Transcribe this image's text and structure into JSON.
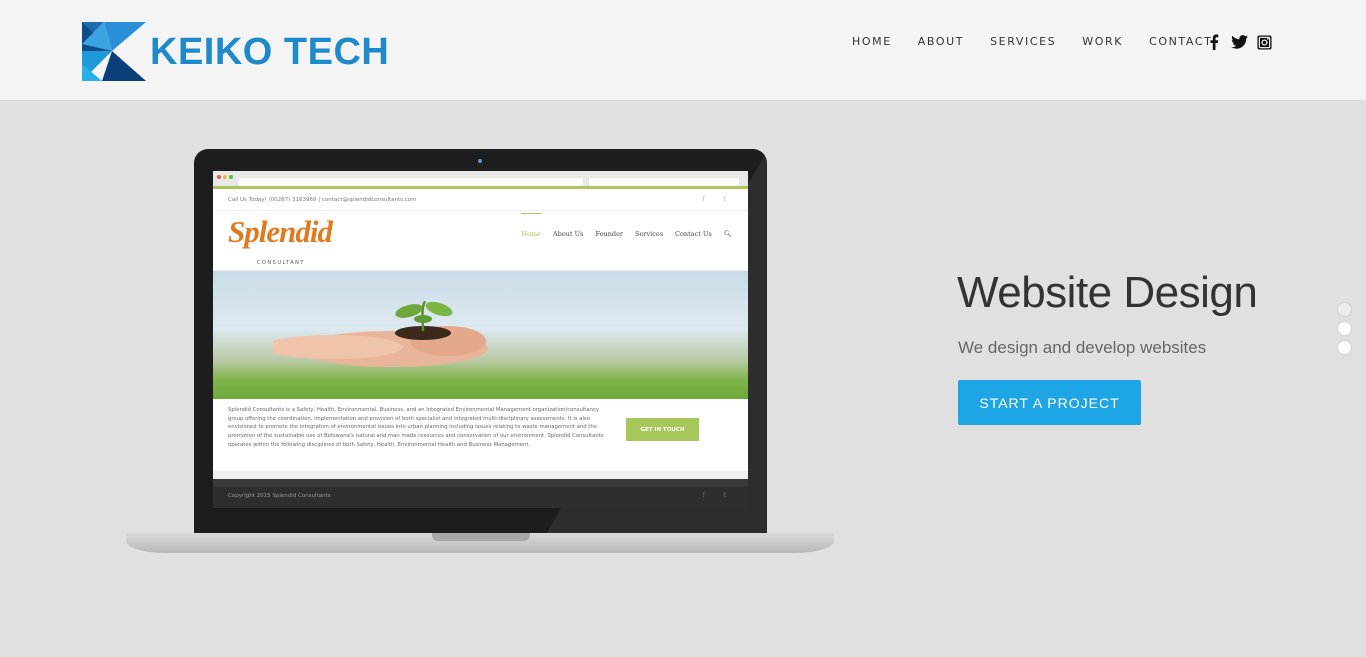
{
  "brand": {
    "name": "KEIKO TECH",
    "color": "#1f8ac9"
  },
  "nav": {
    "items": [
      {
        "label": "HOME"
      },
      {
        "label": "ABOUT"
      },
      {
        "label": "SERVICES"
      },
      {
        "label": "WORK"
      },
      {
        "label": "CONTACT"
      }
    ],
    "social": [
      "facebook-icon",
      "twitter-icon",
      "instagram-icon"
    ]
  },
  "mockup": {
    "call_line": "Call Us Today! (00267) 3163969  |  contact@splendidconsultants.com",
    "logo_main": "Splendid",
    "logo_sub": "CONSULTANT",
    "site_nav": [
      "Home",
      "About Us",
      "Founder",
      "Services",
      "Contact Us"
    ],
    "body_text": "Splendid Consultants is a Safety, Health, Environmental, Business, and an Integrated Environmental Management organization/consultancy group offering the coordination, implementation and provision of both specialist and integrated multi-disciplinary assessments. It is also envisioned to promote the integration of environmental issues into urban planning including issues relating to waste management and the promotion of the sustainable use of Botswana's natural and man made resources and conservation of our environment. Splendid Consultants operates within the following disciplines of both Safety, Health, Environmental Health and Business Management.",
    "cta_label": "GET IN TOUCH",
    "copyright": "Copyright 2015 Splendid Consultants",
    "accent": "#a6c85a"
  },
  "hero": {
    "title": "Website Design",
    "subtitle": "We design and develop websites",
    "cta_label": "START A PROJECT",
    "cta_color": "#1ea5e6"
  },
  "slider": {
    "count": 3,
    "active_index": 0
  }
}
